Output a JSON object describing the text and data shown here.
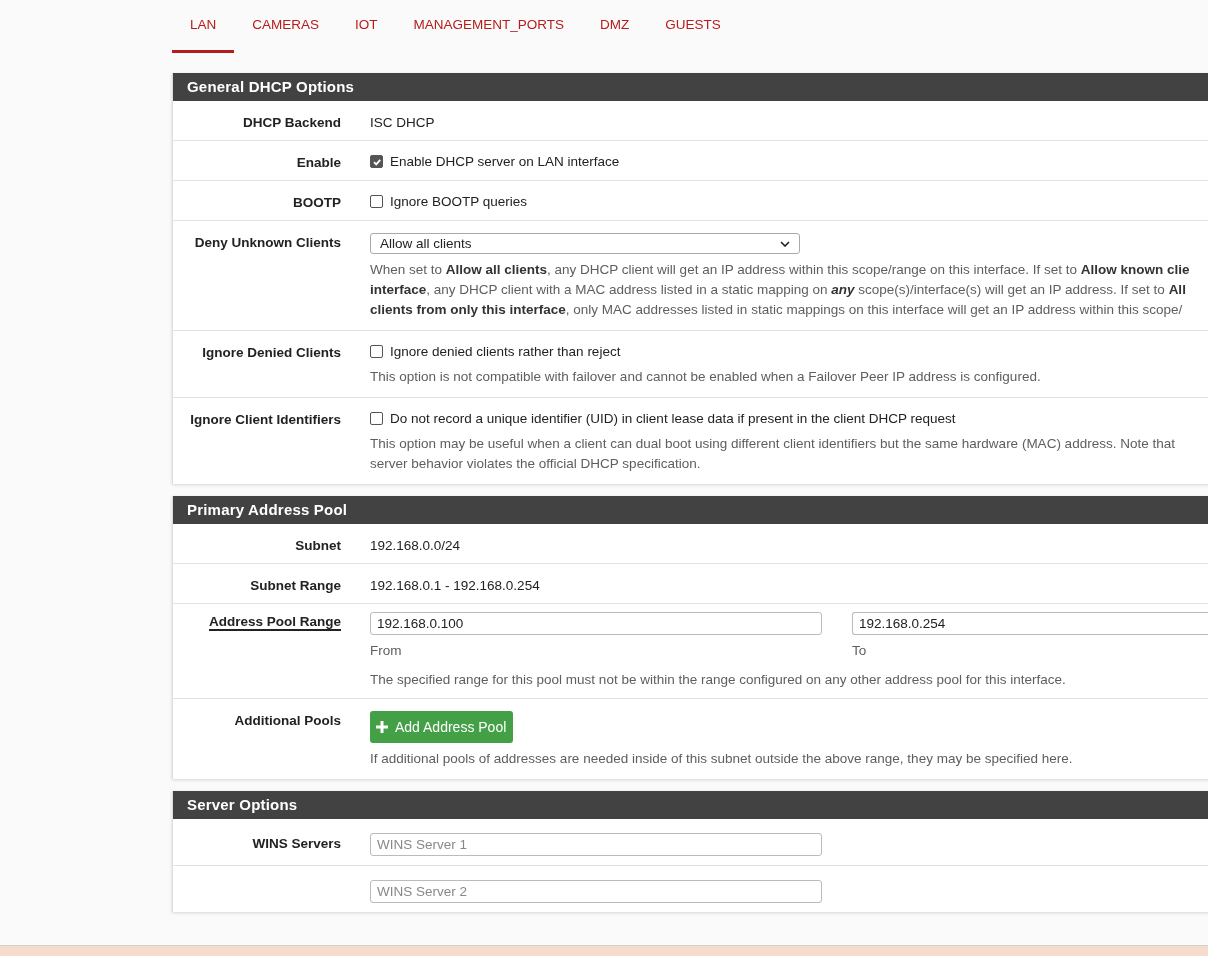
{
  "tabs": [
    {
      "label": "LAN",
      "selected": true
    },
    {
      "label": "CAMERAS",
      "selected": false
    },
    {
      "label": "IOT",
      "selected": false
    },
    {
      "label": "MANAGEMENT_PORTS",
      "selected": false
    },
    {
      "label": "DMZ",
      "selected": false
    },
    {
      "label": "GUESTS",
      "selected": false
    }
  ],
  "sections": [
    {
      "title": "General DHCP Options",
      "rows": [
        {
          "kind": "text",
          "label": "DHCP Backend",
          "underlined": false,
          "value": "ISC DHCP"
        },
        {
          "kind": "checkbox",
          "label": "Enable",
          "underlined": false,
          "checked": true,
          "text": "Enable DHCP server on LAN interface"
        },
        {
          "kind": "checkbox",
          "label": "BOOTP",
          "underlined": false,
          "checked": false,
          "text": "Ignore BOOTP queries"
        },
        {
          "kind": "select",
          "label": "Deny Unknown Clients",
          "underlined": false,
          "value": "Allow all clients",
          "help_lines": [
            "When set to **Allow all clients**, any DHCP client will get an IP address within this scope/range on this interface. If set to **Allow known clie**",
            "**interface**, any DHCP client with a MAC address listed in a static mapping on *any* scope(s)/interface(s) will get an IP address. If set to **All**",
            "**clients from only this interface**, only MAC addresses listed in static mappings on this interface will get an IP address within this scope/"
          ]
        },
        {
          "kind": "checkbox",
          "label": "Ignore Denied Clients",
          "underlined": false,
          "checked": false,
          "text": "Ignore denied clients rather than reject",
          "help_lines": [
            "This option is not compatible with failover and cannot be enabled when a Failover Peer IP address is configured."
          ]
        },
        {
          "kind": "checkbox",
          "label": "Ignore Client Identifiers",
          "underlined": false,
          "checked": false,
          "text": "Do not record a unique identifier (UID) in client lease data if present in the client DHCP request",
          "help_lines": [
            "This option may be useful when a client can dual boot using different client identifiers but the same hardware (MAC) address. Note that",
            "server behavior violates the official DHCP specification."
          ]
        }
      ]
    },
    {
      "title": "Primary Address Pool",
      "rows": [
        {
          "kind": "text",
          "label": "Subnet",
          "underlined": false,
          "value": "192.168.0.0/24"
        },
        {
          "kind": "text",
          "label": "Subnet Range",
          "underlined": false,
          "value": "192.168.0.1 - 192.168.0.254"
        },
        {
          "kind": "range",
          "label": "Address Pool Range",
          "underlined": true,
          "from_value": "192.168.0.100",
          "from_caption": "From",
          "to_value": "192.168.0.254",
          "to_caption": "To",
          "help_lines": [
            "The specified range for this pool must not be within the range configured on any other address pool for this interface."
          ]
        },
        {
          "kind": "button",
          "label": "Additional Pools",
          "underlined": false,
          "button": "Add Address Pool",
          "help_lines": [
            "If additional pools of addresses are needed inside of this subnet outside the above range, they may be specified here."
          ]
        }
      ]
    },
    {
      "title": "Server Options",
      "rows": [
        {
          "kind": "input",
          "label": "WINS Servers",
          "underlined": false,
          "placeholder": "WINS Server 1"
        },
        {
          "kind": "input",
          "placeholder": "WINS Server 2"
        }
      ]
    }
  ]
}
